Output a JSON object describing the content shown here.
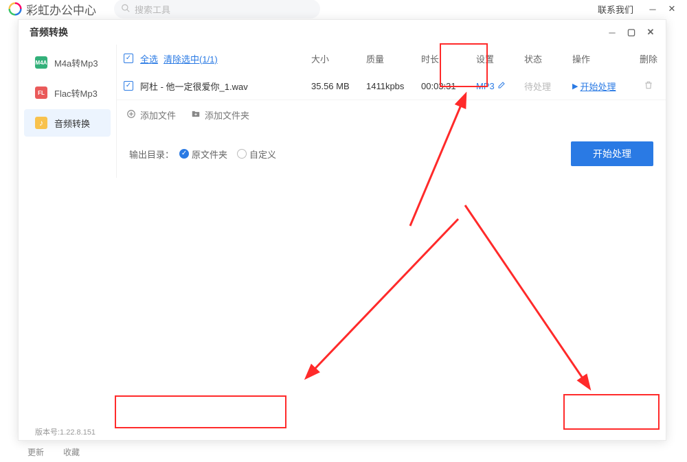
{
  "outer": {
    "title": "彩虹办公中心",
    "search_placeholder": "搜索工具",
    "contact": "联系我们"
  },
  "dialog": {
    "title": "音频转换",
    "version": "版本号:1.22.8.151",
    "sidebar": {
      "items": [
        {
          "label": "M4a转Mp3"
        },
        {
          "label": "Flac转Mp3"
        },
        {
          "label": "音频转换"
        }
      ]
    },
    "table": {
      "head": {
        "select_all": "全选",
        "clear_sel": "清除选中(1/1)",
        "size": "大小",
        "quality": "质量",
        "duration": "时长",
        "setting": "设置",
        "state": "状态",
        "operation": "操作",
        "delete": "删除"
      },
      "rows": [
        {
          "name": "阿杜 - 他一定很爱你_1.wav",
          "size": "35.56 MB",
          "quality": "1411kpbs",
          "duration": "00:03:31",
          "setting": "MP3",
          "state": "待处理",
          "operation": "开始处理"
        }
      ]
    },
    "addrow": {
      "add_file": "添加文件",
      "add_folder": "添加文件夹"
    },
    "footer": {
      "output_label": "输出目录：",
      "opt_original": "原文件夹",
      "opt_custom": "自定义",
      "start": "开始处理"
    }
  },
  "bg_nav": {
    "a": "更新",
    "b": "收藏"
  }
}
